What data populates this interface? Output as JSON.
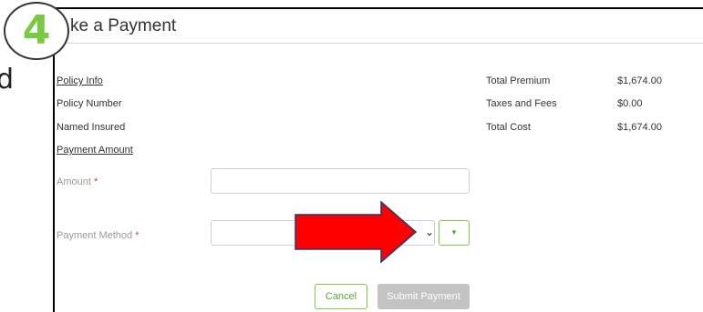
{
  "background_fragment": "d",
  "step_badge": "4",
  "modal": {
    "title": "ke a Payment"
  },
  "left": {
    "policy_info": "Policy Info",
    "policy_number": "Policy Number",
    "named_insured": "Named Insured",
    "payment_amount": "Payment Amount"
  },
  "summary": {
    "rows": [
      {
        "label": "Total Premium",
        "value": "$1,674.00"
      },
      {
        "label": "Taxes and Fees",
        "value": "$0.00"
      },
      {
        "label": "Total Cost",
        "value": "$1,674.00"
      }
    ]
  },
  "form": {
    "amount_label": "Amount",
    "amount_value": "",
    "method_label": "Payment Method",
    "method_value": "",
    "required_marker": "*"
  },
  "buttons": {
    "cancel": "Cancel",
    "submit": "Submit Payment"
  },
  "icons": {
    "select_chevron": "chevron-down-icon",
    "add": "caret-down-icon",
    "annotation": "red-arrow-icon"
  },
  "colors": {
    "accent": "#7ac943",
    "arrow": "#ff0000",
    "submit_disabled": "#c3c3c3"
  }
}
